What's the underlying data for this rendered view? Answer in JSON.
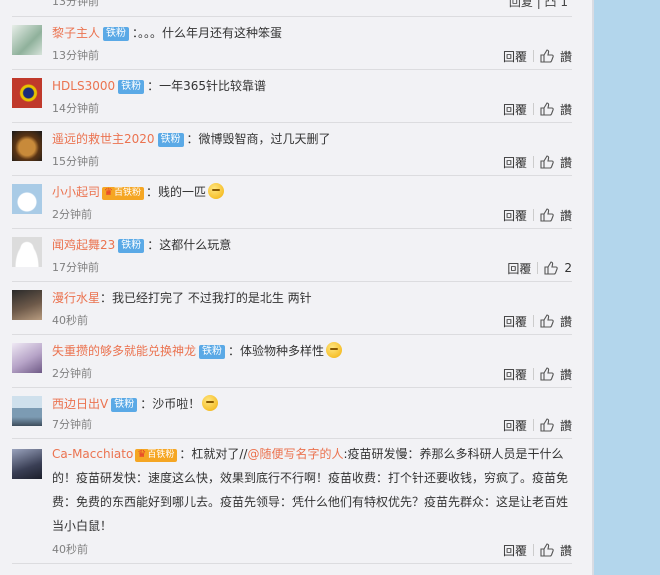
{
  "top_partial": {
    "time": "13分钟前",
    "action": "回复 | 凸 1"
  },
  "comments": [
    {
      "user": "黎子主人",
      "badge": "铁粉",
      "vip": "",
      "text": "：。。。什么年月还有这种笨蛋",
      "mention": "",
      "time": "13分钟前",
      "reply": "回覆",
      "like": "讚",
      "avatar_color": "#8fb19b"
    },
    {
      "user": "HDLS3000",
      "badge": "铁粉",
      "vip": "",
      "text": "：一年365针比较靠谱",
      "mention": "",
      "time": "14分钟前",
      "reply": "回覆",
      "like": "讚",
      "avatar_color": "#c0392b"
    },
    {
      "user": "遥远的救世主2020",
      "badge": "铁粉",
      "vip": "",
      "text": "：微博毁智商，过几天删了",
      "mention": "",
      "time": "15分钟前",
      "reply": "回覆",
      "like": "讚",
      "avatar_color": "#7a4a1e"
    },
    {
      "user": "小小起司",
      "badge": "铁粉",
      "vip": "百",
      "text": "：贱的一匹",
      "mention": "",
      "time": "2分钟前",
      "reply": "回覆",
      "like": "讚",
      "avatar_color": "#a9cbe6"
    },
    {
      "user": "闻鸡起舞23",
      "badge": "铁粉",
      "vip": "",
      "text": "：这都什么玩意",
      "mention": "",
      "time": "17分钟前",
      "reply": "回覆",
      "like": "2",
      "avatar_color": "#e6e6e6"
    },
    {
      "user": "漫行水星",
      "badge": "",
      "vip": "",
      "text": "：我已经打完了 不过我打的是北生 两针",
      "mention": "",
      "time": "40秒前",
      "reply": "回覆",
      "like": "讚",
      "avatar_color": "#5b4a3f"
    },
    {
      "user": "失重攒的够多就能兑换神龙",
      "badge": "铁粉",
      "vip": "",
      "text": "：体验物种多样性",
      "mention": "",
      "time": "2分钟前",
      "reply": "回覆",
      "like": "讚",
      "avatar_color": "#b6a3c7"
    },
    {
      "user": "西边日出V",
      "badge": "铁粉",
      "vip": "",
      "text": "：沙币啦！",
      "mention": "",
      "time": "7分钟前",
      "reply": "回覆",
      "like": "讚",
      "avatar_color": "#7c9bb3"
    },
    {
      "user": "Ca-Macchiato",
      "badge": "铁粉",
      "vip": "百",
      "text_pre": "：杠就对了//",
      "mention": "@随便写名字的人",
      "text": ":疫苗研发慢：养那么多科研人员是干什么的！疫苗研发快：速度这么快，效果到底行不行啊！疫苗收费：打个针还要收钱，穷疯了。疫苗免费：免费的东西能好到哪儿去。疫苗先领导：凭什么他们有特权优先？疫苗先群众：这是让老百姓当小白鼠！",
      "time": "40秒前",
      "reply": "回覆",
      "like": "讚",
      "avatar_color": "#3a3f55"
    }
  ]
}
